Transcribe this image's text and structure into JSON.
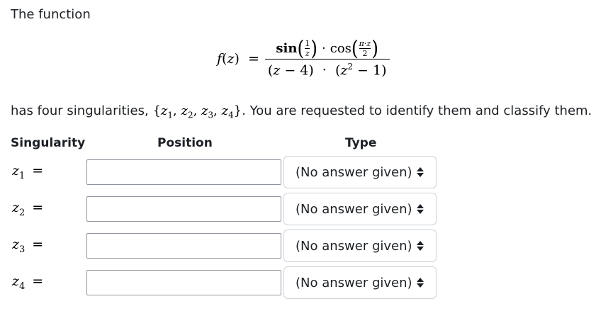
{
  "intro_text": "The function",
  "formula": {
    "lhs_f": "f",
    "lhs_open": "(",
    "lhs_var": "z",
    "lhs_close": ")",
    "lhs_eq": "=",
    "numerator": {
      "sin": "sin",
      "sin_frac_num": "1",
      "sin_frac_den": "z",
      "dot": "·",
      "cos": "cos",
      "cos_frac_num": "π·z",
      "cos_frac_den": "2"
    },
    "denominator": {
      "part1_open": "(",
      "part1_var": "z",
      "part1_rest": " − 4)",
      "dot": "·",
      "part2_open": "(",
      "part2_var": "z",
      "part2_exp": "2",
      "part2_rest": " − 1)"
    }
  },
  "sentence": {
    "prefix": "has four singularities, ",
    "set_open": "{",
    "z": "z",
    "subs": [
      "1",
      "2",
      "3",
      "4"
    ],
    "sep": ", ",
    "set_close": "}",
    "suffix": ".  You are requested to identify them and classify them."
  },
  "headers": {
    "singularity": "Singularity",
    "position": "Position",
    "type": "Type"
  },
  "rows": [
    {
      "var": "z",
      "sub": "1",
      "eq": "=",
      "position_value": "",
      "type_value": "(No answer given)"
    },
    {
      "var": "z",
      "sub": "2",
      "eq": "=",
      "position_value": "",
      "type_value": "(No answer given)"
    },
    {
      "var": "z",
      "sub": "3",
      "eq": "=",
      "position_value": "",
      "type_value": "(No answer given)"
    },
    {
      "var": "z",
      "sub": "4",
      "eq": "=",
      "position_value": "",
      "type_value": "(No answer given)"
    }
  ]
}
